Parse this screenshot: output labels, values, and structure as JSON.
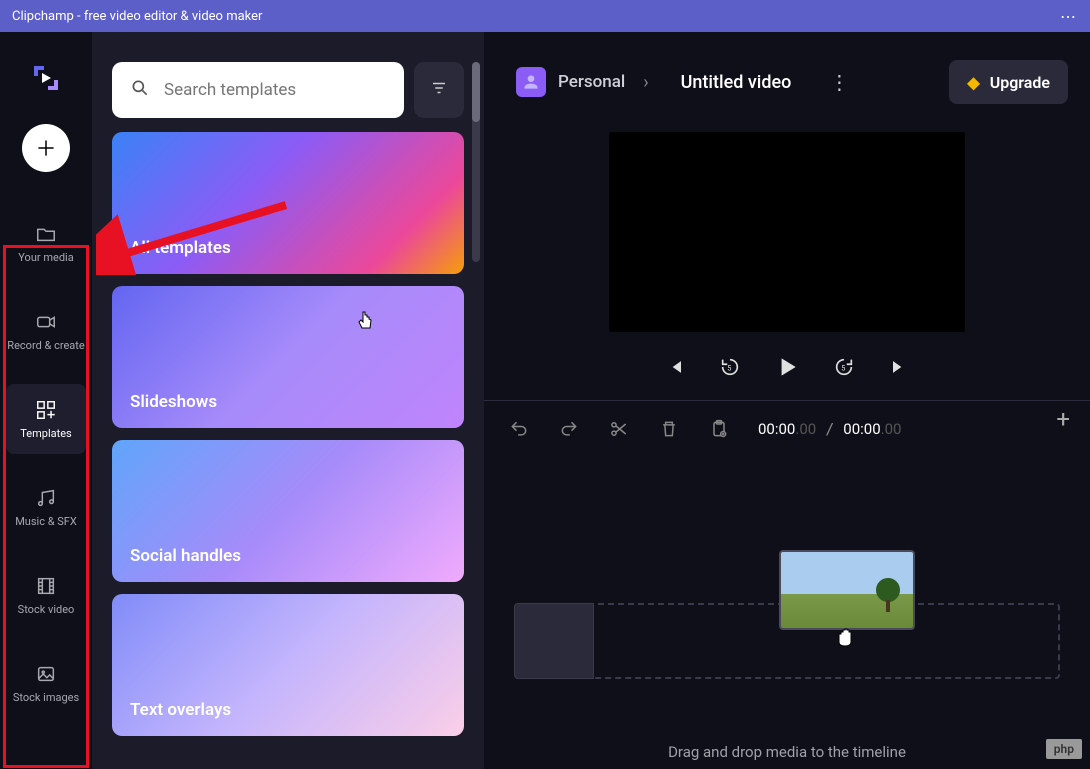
{
  "window": {
    "title": "Clipchamp - free video editor & video maker"
  },
  "sidebar": {
    "items": [
      {
        "label": "Your media"
      },
      {
        "label": "Record & create"
      },
      {
        "label": "Templates"
      },
      {
        "label": "Music & SFX"
      },
      {
        "label": "Stock video"
      },
      {
        "label": "Stock images"
      }
    ]
  },
  "search": {
    "placeholder": "Search templates"
  },
  "templates": [
    {
      "label": "All templates"
    },
    {
      "label": "Slideshows"
    },
    {
      "label": "Social handles"
    },
    {
      "label": "Text overlays"
    }
  ],
  "header": {
    "workspace": "Personal",
    "project": "Untitled video",
    "upgrade": "Upgrade"
  },
  "timeline": {
    "current": "00:00",
    "current_ms": ".00",
    "total": "00:00",
    "total_ms": ".00",
    "hint": "Drag and drop media to the timeline"
  },
  "watermark": "php"
}
